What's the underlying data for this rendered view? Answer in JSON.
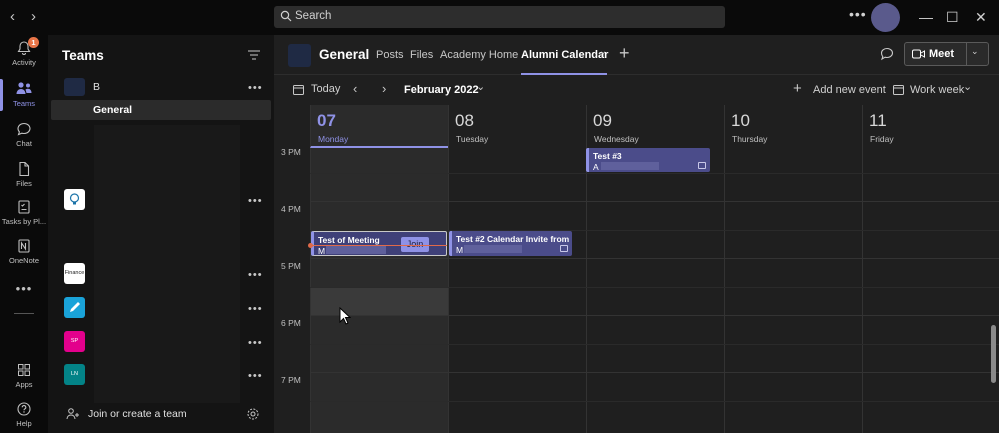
{
  "titlebar": {
    "back_icon": "‹",
    "forward_icon": "›",
    "search_placeholder": "Search",
    "more_icon": "•••",
    "minimize_icon": "—",
    "maximize_icon": "☐",
    "close_icon": "✕"
  },
  "rail": {
    "items": [
      {
        "label": "Activity",
        "icon": "bell-icon",
        "badge": "1"
      },
      {
        "label": "Teams",
        "icon": "teams-icon"
      },
      {
        "label": "Chat",
        "icon": "chat-icon"
      },
      {
        "label": "Files",
        "icon": "files-icon"
      },
      {
        "label": "Tasks by Pl...",
        "icon": "tasks-icon"
      },
      {
        "label": "OneNote",
        "icon": "onenote-icon"
      },
      {
        "label": "Apps",
        "icon": "apps-icon"
      },
      {
        "label": "Help",
        "icon": "help-icon"
      }
    ],
    "more_icon": "•••"
  },
  "teams_panel": {
    "title": "Teams",
    "team_b_name": "B",
    "selected_channel": "General",
    "dots": "•••",
    "tiles": [
      {
        "label": "",
        "color": "#ffffff"
      },
      {
        "label": "Finance",
        "color": "#ffffff"
      },
      {
        "label": "",
        "color": "#1aa3d9"
      },
      {
        "label": "SP",
        "color": "#e3008c"
      },
      {
        "label": "LN",
        "color": "#038387"
      }
    ],
    "join_label": "Join or create a team"
  },
  "channel": {
    "name": "General",
    "tabs": [
      "Posts",
      "Files",
      "Academy Home",
      "Alumni Calendar"
    ],
    "active_tab": "Alumni Calendar",
    "tab_chevron": "⌄",
    "add_tab": "+",
    "meet_label": "Meet",
    "meet_chevron": "⌄"
  },
  "calendar_toolbar": {
    "today": "Today",
    "prev": "‹",
    "next": "›",
    "month": "February 2022",
    "month_chevron": "⌄",
    "add_event": "Add new event",
    "view": "Work week",
    "view_chevron": "⌄"
  },
  "days": [
    {
      "num": "07",
      "name": "Monday",
      "today": true
    },
    {
      "num": "08",
      "name": "Tuesday"
    },
    {
      "num": "09",
      "name": "Wednesday"
    },
    {
      "num": "10",
      "name": "Thursday"
    },
    {
      "num": "11",
      "name": "Friday"
    }
  ],
  "times": [
    "3 PM",
    "4 PM",
    "5 PM",
    "6 PM",
    "7 PM"
  ],
  "events": [
    {
      "title": "Test #3",
      "organizer": "A"
    },
    {
      "title": "Test of Meeting",
      "organizer": "M",
      "join": "Join"
    },
    {
      "title": "Test #2 Calendar Invite from",
      "organizer": "M"
    }
  ],
  "colors": {
    "accent": "#8f92e6",
    "event_bg": "#4b4c8a",
    "now_line": "#e06a4a",
    "badge": "#e97548"
  }
}
